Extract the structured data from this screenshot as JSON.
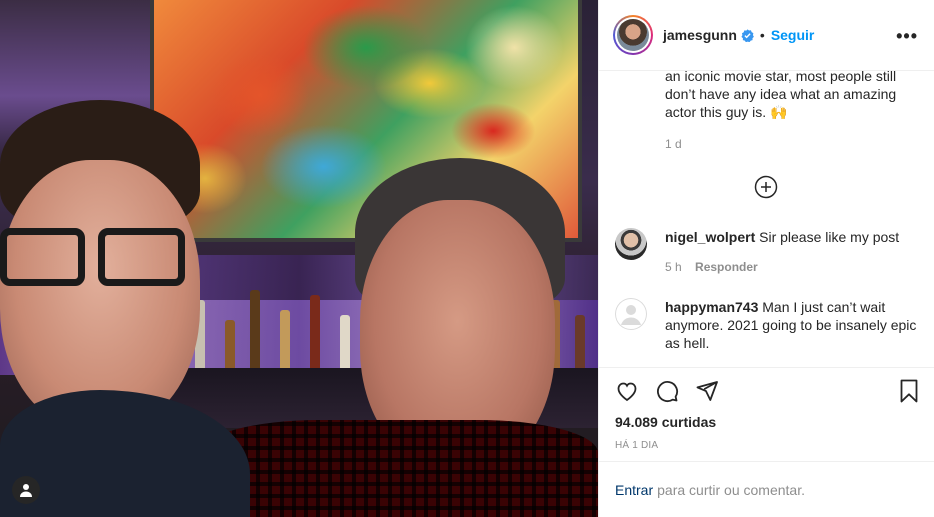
{
  "header": {
    "username": "jamesgunn",
    "separator": "•",
    "follow_label": "Seguir",
    "more_label": "•••"
  },
  "caption": {
    "text": "an iconic movie star, most people still don’t have any idea what an amazing actor this guy is. 🙌",
    "time": "1 d"
  },
  "comments": [
    {
      "username": "nigel_wolpert",
      "text": "Sir please like my post",
      "time": "5 h",
      "reply_label": "Responder"
    },
    {
      "username": "happyman743",
      "text": "Man I just can’t wait anymore. 2021 going to be insanely epic as hell."
    }
  ],
  "actions": {
    "likes": "94.089 curtidas",
    "posted": "HÁ 1 DIA"
  },
  "login": {
    "link": "Entrar",
    "text": "para curtir ou comentar."
  },
  "colors": {
    "accent": "#0095f6",
    "text": "#262626",
    "muted": "#8e8e8e",
    "border": "#efefef"
  },
  "icons": [
    "user-tag-icon",
    "verified-icon",
    "more-icon",
    "add-circle-icon",
    "heart-icon",
    "comment-icon",
    "share-icon",
    "bookmark-icon"
  ]
}
